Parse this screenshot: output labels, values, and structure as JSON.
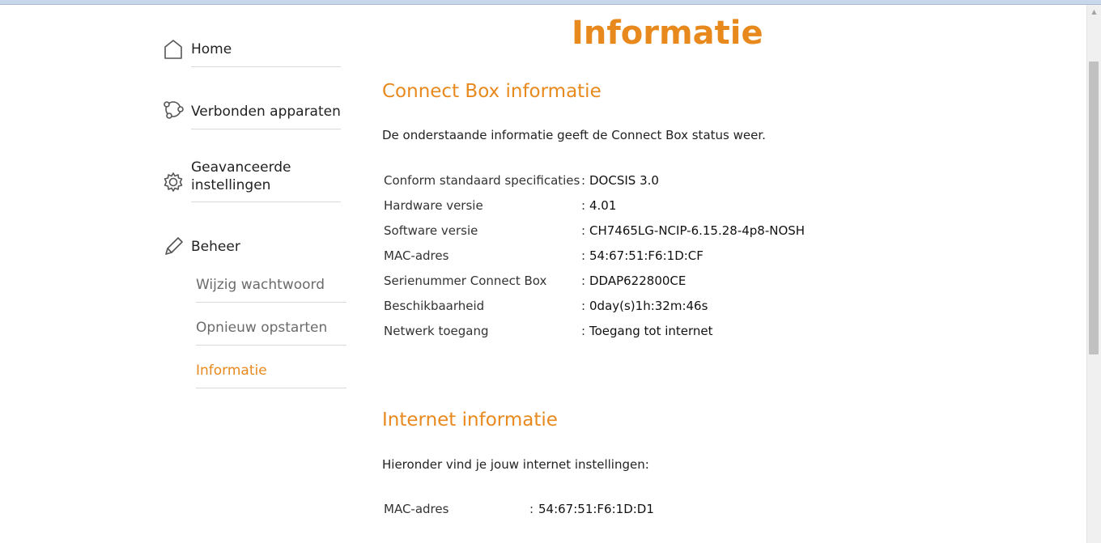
{
  "sidebar": {
    "main_items": [
      {
        "label": "Home",
        "icon": "home-icon"
      },
      {
        "label": "Verbonden apparaten",
        "icon": "devices-icon"
      },
      {
        "label": "Geavanceerde instellingen",
        "icon": "gear-icon"
      },
      {
        "label": "Beheer",
        "icon": "pencil-icon"
      }
    ],
    "sub_items": [
      {
        "label": "Wijzig wachtwoord",
        "active": false
      },
      {
        "label": "Opnieuw opstarten",
        "active": false
      },
      {
        "label": "Informatie",
        "active": true
      }
    ]
  },
  "page": {
    "title": "Informatie"
  },
  "connect_box": {
    "heading": "Connect Box informatie",
    "intro": "De onderstaande informatie geeft de Connect Box status weer.",
    "rows": [
      {
        "key": "Conform standaard specificaties",
        "value": "DOCSIS 3.0"
      },
      {
        "key": "Hardware versie",
        "value": "4.01"
      },
      {
        "key": "Software versie",
        "value": "CH7465LG-NCIP-6.15.28-4p8-NOSH"
      },
      {
        "key": "MAC-adres",
        "value": "54:67:51:F6:1D:CF"
      },
      {
        "key": "Serienummer Connect Box",
        "value": "DDAP622800CE"
      },
      {
        "key": "Beschikbaarheid",
        "value": "0day(s)1h:32m:46s"
      },
      {
        "key": "Netwerk toegang",
        "value": "Toegang tot internet"
      }
    ]
  },
  "internet": {
    "heading": "Internet informatie",
    "intro": "Hieronder vind je jouw internet instellingen:",
    "rows": [
      {
        "key": "MAC-adres",
        "value": "54:67:51:F6:1D:D1"
      }
    ]
  },
  "separator": ":",
  "colors": {
    "accent": "#e8891e",
    "text": "#222222",
    "muted": "#6b6b6b",
    "rule": "#d9d9d9"
  }
}
